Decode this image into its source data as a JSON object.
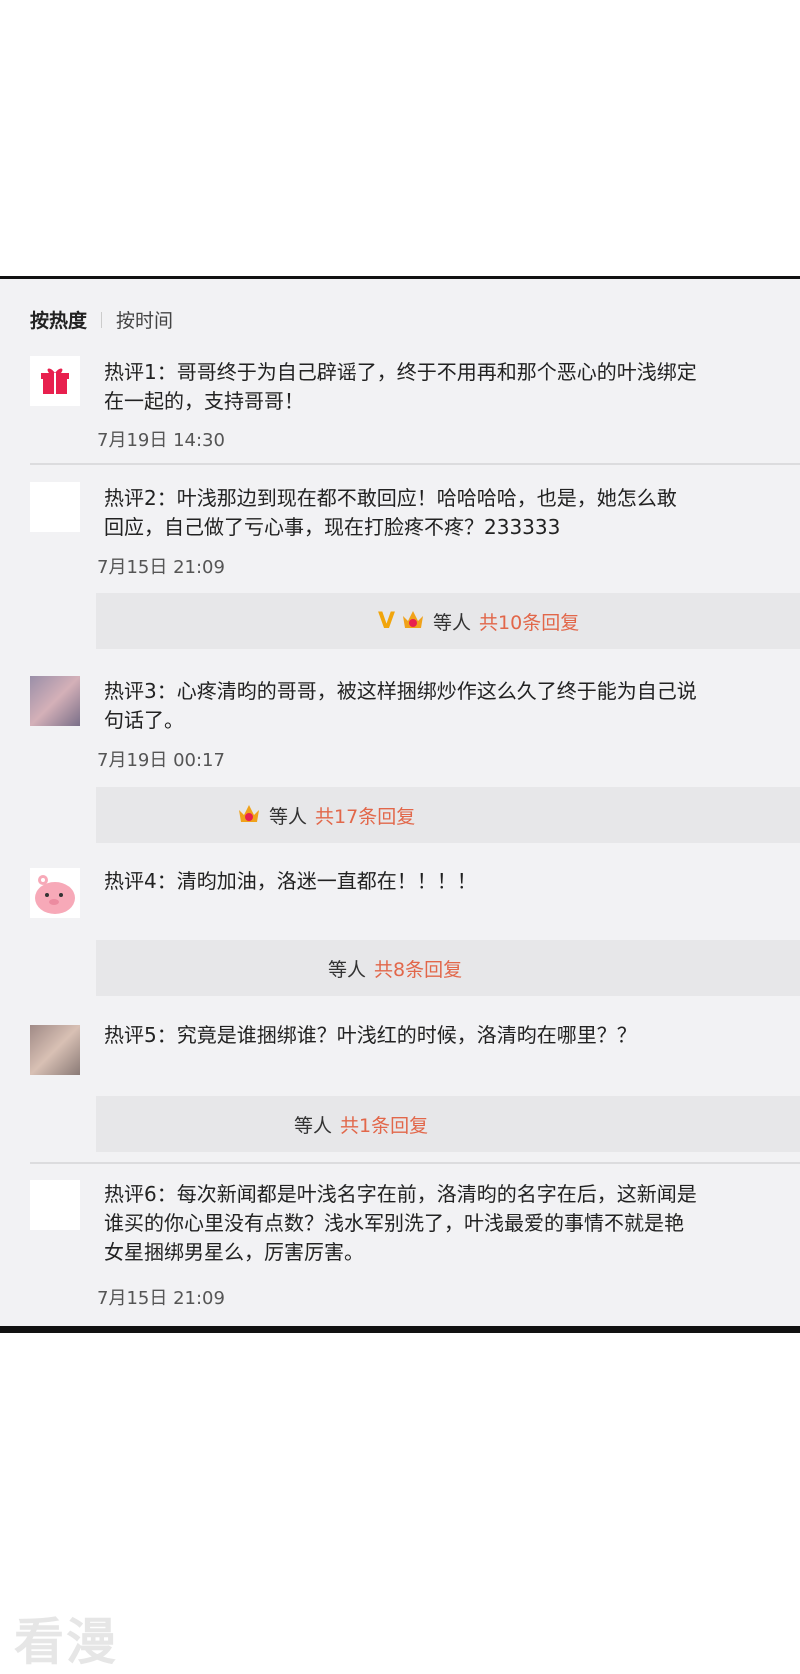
{
  "sort_tabs": {
    "hot": "按热度",
    "time": "按时间"
  },
  "comments": [
    {
      "text": "热评1：哥哥终于为自己辟谣了，终于不用再和那个恶心的叶浅绑定\n在一起的，支持哥哥！",
      "time": "7月19日 14:30"
    },
    {
      "text": "热评2：叶浅那边到现在都不敢回应！哈哈哈哈，也是，她怎么敢\n回应，自己做了亏心事，现在打脸疼不疼？233333",
      "time": "7月15日 21:09",
      "reply": {
        "who": "等人",
        "count": "共10条回复"
      }
    },
    {
      "text": "热评3：心疼清昀的哥哥，被这样捆绑炒作这么久了终于能为自己说\n句话了。",
      "time": "7月19日 00:17",
      "reply": {
        "who": "等人",
        "count": "共17条回复"
      }
    },
    {
      "text": "热评4：清昀加油，洛迷一直都在！！！！",
      "reply": {
        "who": "等人",
        "count": "共8条回复"
      }
    },
    {
      "text": "热评5：究竟是谁捆绑谁？叶浅红的时候，洛清昀在哪里？？",
      "reply": {
        "who": "等人",
        "count": "共1条回复"
      }
    },
    {
      "text": "热评6：每次新闻都是叶浅名字在前，洛清昀的名字在后，这新闻是\n谁买的你心里没有点数？浅水军别洗了，叶浅最爱的事情不就是艳\n女星捆绑男星么，厉害厉害。",
      "time": "7月15日 21:09"
    }
  ],
  "watermark": "看漫",
  "colors": {
    "reply_count": "#e2674a",
    "panel_bg": "#f2f2f4",
    "reply_bg": "#e7e7e9"
  }
}
